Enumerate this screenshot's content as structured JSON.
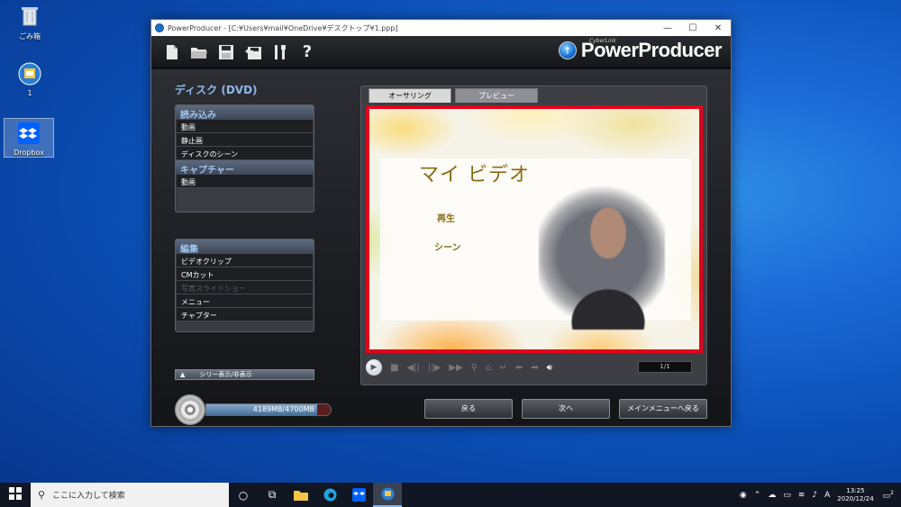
{
  "desktop": {
    "icons": [
      {
        "label": "ごみ箱",
        "icon": "recycle-bin-icon"
      },
      {
        "label": "1",
        "icon": "powerproducer-file-icon"
      },
      {
        "label": "Dropbox",
        "icon": "dropbox-icon"
      }
    ]
  },
  "window": {
    "title": "PowerProducer - [C:¥Users¥mail¥OneDrive¥デスクトップ¥1.ppp]",
    "controls": {
      "minimize": "—",
      "maximize": "☐",
      "close": "✕"
    },
    "brand": {
      "name": "PowerProducer",
      "small": "CyberLink"
    },
    "toolbar": [
      {
        "name": "new-file-icon",
        "glyph": "▯"
      },
      {
        "name": "open-folder-icon",
        "glyph": "▭"
      },
      {
        "name": "save-icon",
        "glyph": "▣"
      },
      {
        "name": "save-as-icon",
        "glyph": "▤"
      },
      {
        "name": "tools-icon",
        "glyph": "╣"
      },
      {
        "name": "help-icon",
        "glyph": "?"
      }
    ],
    "section_title": "ディスク (DVD)",
    "import_panel": {
      "header1": "読み込み",
      "items1": [
        "動画",
        "静止画",
        "ディスクのシーン"
      ],
      "header2": "キャプチャー",
      "items2": [
        "動画"
      ]
    },
    "edit_panel": {
      "header": "編集",
      "items": [
        "ビデオクリップ",
        "CMカット",
        "写真スライドショー",
        "メニュー",
        "チャプター"
      ],
      "disabled_index": 2
    },
    "series_toggle": "シリー表示/非表示",
    "capacity": {
      "text": "4189MB/4700MB",
      "used_mb": 4189,
      "total_mb": 4700
    },
    "tabs": {
      "authoring": "オーサリング",
      "preview": "プレビュー"
    },
    "menu_preview": {
      "title": "マイ ビデオ",
      "items": [
        "再生",
        "シーン"
      ]
    },
    "player": {
      "page": "1/1"
    },
    "buttons": {
      "back": "戻る",
      "next": "次へ",
      "main_menu": "メインメニューへ戻る"
    }
  },
  "taskbar": {
    "search_placeholder": "ここに入力して検索",
    "ime": "A",
    "time": "13:25",
    "date": "2020/12/24",
    "notifications": "2"
  }
}
